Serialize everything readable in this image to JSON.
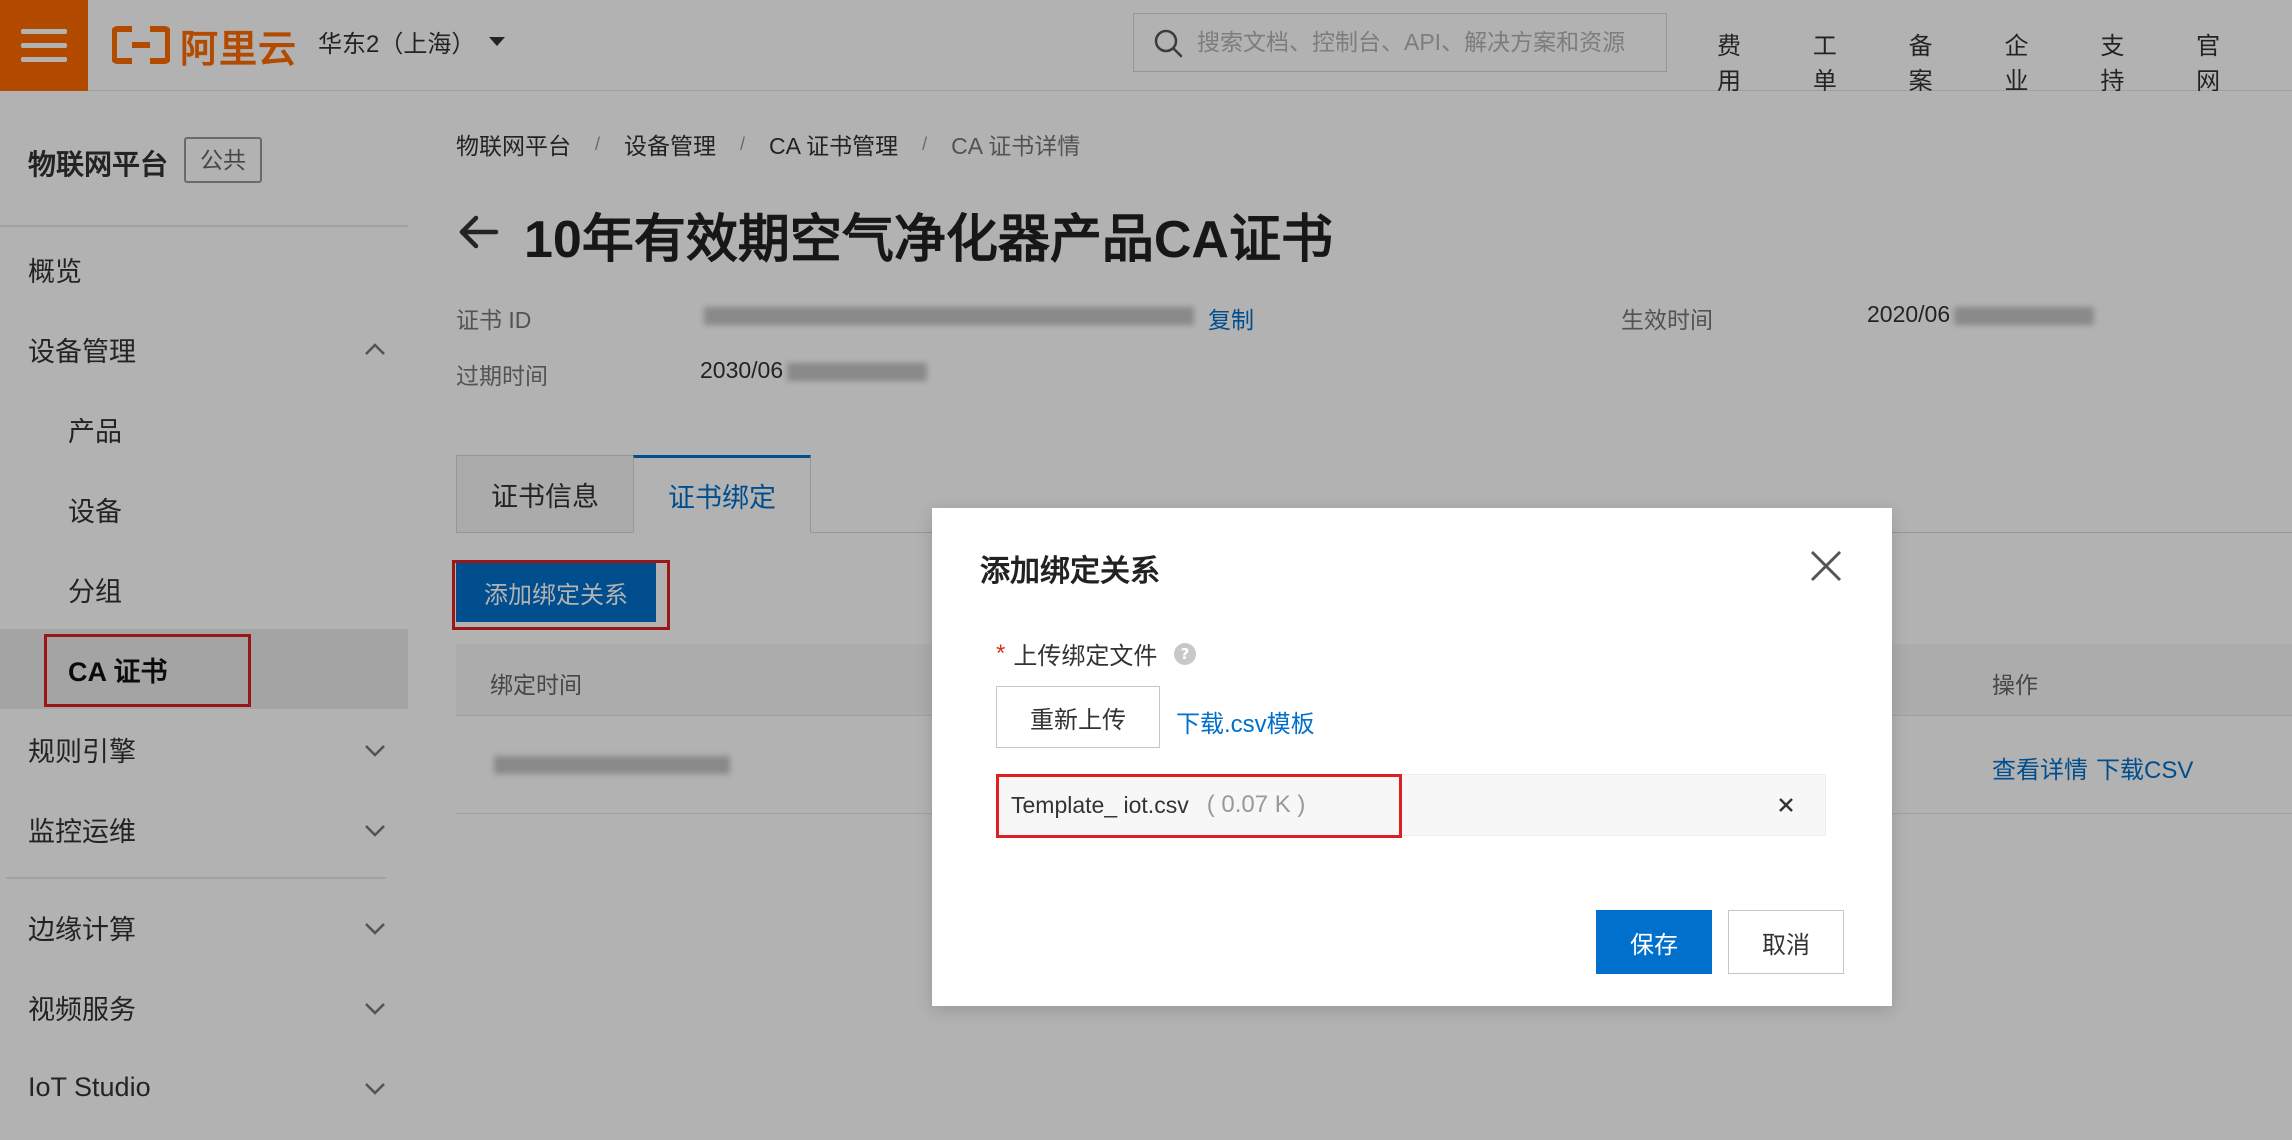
{
  "topbar": {
    "logo_text": "阿里云",
    "region": "华东2（上海）",
    "search_placeholder": "搜索文档、控制台、API、解决方案和资源",
    "nav": [
      "费用",
      "工单",
      "备案",
      "企业",
      "支持",
      "官网"
    ],
    "brand_color": "#ff6a00"
  },
  "sidebar": {
    "product": "物联网平台",
    "badge": "公共",
    "items": {
      "overview": "概览",
      "device_mgmt": "设备管理",
      "product": "产品",
      "device": "设备",
      "group": "分组",
      "ca_cert": "CA 证书",
      "rule_engine": "规则引擎",
      "monitor": "监控运维",
      "edge": "边缘计算",
      "video": "视频服务",
      "iot_studio": "IoT Studio"
    }
  },
  "breadcrumb": [
    "物联网平台",
    "设备管理",
    "CA 证书管理",
    "CA 证书详情"
  ],
  "page_title": "10年有效期空气净化器产品CA证书",
  "info": {
    "cert_id_label": "证书 ID",
    "copy_link": "复制",
    "effective_label": "生效时间",
    "effective_value": "2020/06",
    "expire_label": "过期时间",
    "expire_value": "2030/06"
  },
  "tabs": [
    "证书信息",
    "证书绑定"
  ],
  "add_binding_button": "添加绑定关系",
  "table": {
    "col_bind_time": "绑定时间",
    "col_actions": "操作",
    "row_view_details": "查看详情",
    "row_download_csv": "下载CSV"
  },
  "dialog": {
    "title": "添加绑定关系",
    "required_mark": "*",
    "upload_label": "上传绑定文件",
    "reupload_button": "重新上传",
    "download_template": "下载.csv模板",
    "file_name": "Template_ iot.csv",
    "file_size": "( 0.07 K )",
    "save_button": "保存",
    "cancel_button": "取消"
  },
  "colors": {
    "primary": "#0070cc",
    "highlight": "#e02020"
  }
}
